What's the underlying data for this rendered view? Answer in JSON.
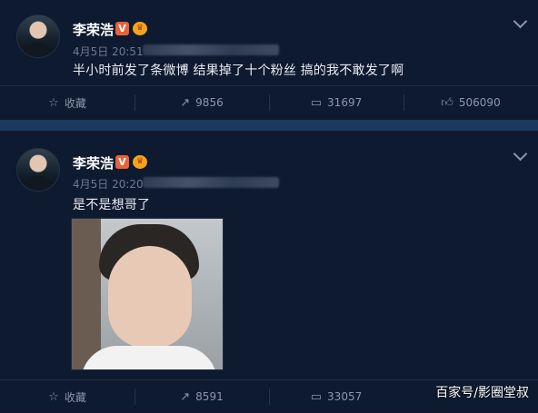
{
  "posts": [
    {
      "author": "李荣浩",
      "verified_badge": "V",
      "time": "4月5日 20:51",
      "text": "半小时前发了条微博 结果掉了十个粉丝 搞的我不敢发了啊",
      "actions": {
        "favorite_label": "收藏",
        "repost_count": "9856",
        "comment_count": "31697",
        "like_count": "506090"
      }
    },
    {
      "author": "李荣浩",
      "verified_badge": "V",
      "time": "4月5日 20:20",
      "text": "是不是想哥了",
      "actions": {
        "favorite_label": "收藏",
        "repost_count": "8591",
        "comment_count": "33057"
      }
    }
  ],
  "watermark": "百家号/影圈堂叔",
  "icons": [
    "star-icon",
    "repost-icon",
    "comment-icon",
    "like-icon",
    "chevron-down-icon",
    "verified-icon",
    "crown-icon"
  ],
  "colors": {
    "background": "#0e1a30",
    "divider": "#1b3a5e",
    "badge": "#e8623a"
  }
}
